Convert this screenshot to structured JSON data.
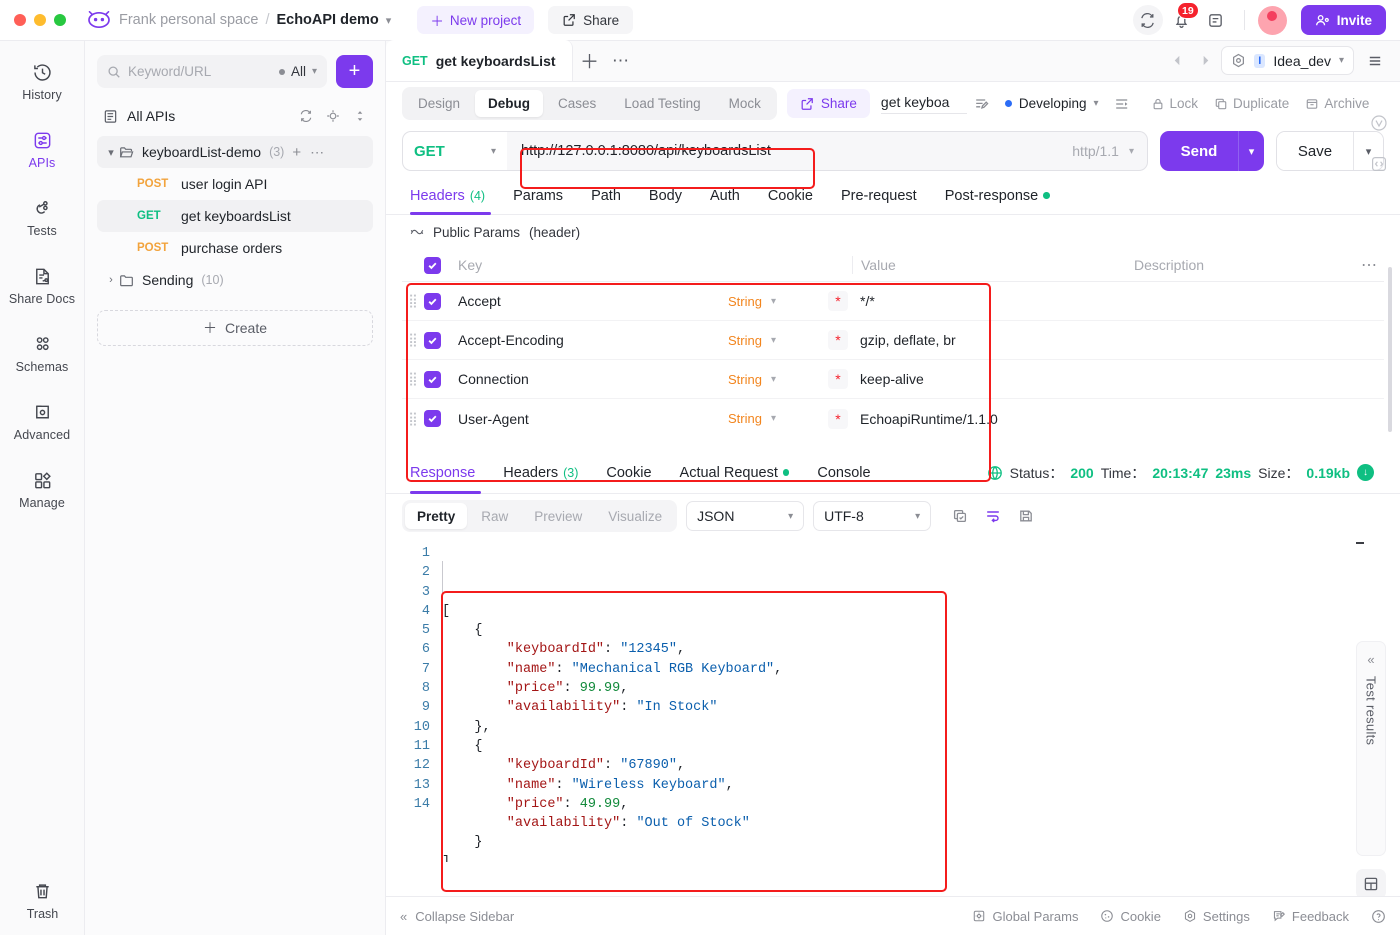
{
  "titlebar": {
    "workspace": "Frank personal space",
    "separator": "/",
    "project": "EchoAPI demo",
    "new_project": "New project",
    "share": "Share",
    "notification_count": "19",
    "invite": "Invite"
  },
  "rail": {
    "items": [
      {
        "label": "History",
        "icon": "history-icon",
        "active": false
      },
      {
        "label": "APIs",
        "icon": "apis-icon",
        "active": true
      },
      {
        "label": "Tests",
        "icon": "tests-icon",
        "active": false
      },
      {
        "label": "Share Docs",
        "icon": "share-docs-icon",
        "active": false
      },
      {
        "label": "Schemas",
        "icon": "schemas-icon",
        "active": false
      },
      {
        "label": "Advanced",
        "icon": "advanced-icon",
        "active": false
      },
      {
        "label": "Manage",
        "icon": "manage-icon",
        "active": false
      }
    ],
    "trash": "Trash"
  },
  "sidebar": {
    "search_placeholder": "Keyword/URL",
    "filter_label": "All",
    "add_button": "+",
    "all_apis": "All APIs",
    "folders": [
      {
        "name": "keyboardList-demo",
        "count": "(3)",
        "expanded": true
      },
      {
        "name": "Sending",
        "count": "(10)",
        "expanded": false
      }
    ],
    "apis": [
      {
        "method": "POST",
        "name": "user login API",
        "selected": false
      },
      {
        "method": "GET",
        "name": "get keyboardsList",
        "selected": true
      },
      {
        "method": "POST",
        "name": "purchase orders",
        "selected": false
      }
    ],
    "create": "Create"
  },
  "tabstrip": {
    "doc_tab_method": "GET",
    "doc_tab_name": "get keyboardsList",
    "env_name": "Idea_dev",
    "env_initial": "I"
  },
  "subbar": {
    "segments": [
      {
        "label": "Design",
        "active": false
      },
      {
        "label": "Debug",
        "active": true
      },
      {
        "label": "Cases",
        "active": false
      },
      {
        "label": "Load Testing",
        "active": false
      },
      {
        "label": "Mock",
        "active": false
      }
    ],
    "share": "Share",
    "api_name_value": "get keyboa",
    "status": "Developing",
    "actions": [
      {
        "label": "Lock",
        "icon": "lock-icon"
      },
      {
        "label": "Duplicate",
        "icon": "duplicate-icon"
      },
      {
        "label": "Archive",
        "icon": "archive-icon"
      }
    ]
  },
  "urlbar": {
    "method": "GET",
    "url": "http://127.0.0.1:8080/api/keyboardsList",
    "protocol": "http/1.1",
    "send": "Send",
    "save": "Save"
  },
  "request_tabs": [
    {
      "label": "Headers",
      "count": "(4)",
      "active": true,
      "dot": false
    },
    {
      "label": "Params",
      "count": "",
      "active": false,
      "dot": false
    },
    {
      "label": "Path",
      "count": "",
      "active": false,
      "dot": false
    },
    {
      "label": "Body",
      "count": "",
      "active": false,
      "dot": false
    },
    {
      "label": "Auth",
      "count": "",
      "active": false,
      "dot": false
    },
    {
      "label": "Cookie",
      "count": "",
      "active": false,
      "dot": false
    },
    {
      "label": "Pre-request",
      "count": "",
      "active": false,
      "dot": false
    },
    {
      "label": "Post-response",
      "count": "",
      "active": false,
      "dot": true
    }
  ],
  "public_params": {
    "label": "Public Params",
    "scope": "(header)"
  },
  "headers_table": {
    "columns": {
      "key": "Key",
      "value": "Value",
      "description": "Description"
    },
    "rows": [
      {
        "checked": true,
        "key": "Accept",
        "type": "String",
        "required": "*",
        "value": "*/*",
        "description": ""
      },
      {
        "checked": true,
        "key": "Accept-Encoding",
        "type": "String",
        "required": "*",
        "value": "gzip, deflate, br",
        "description": ""
      },
      {
        "checked": true,
        "key": "Connection",
        "type": "String",
        "required": "*",
        "value": "keep-alive",
        "description": ""
      },
      {
        "checked": true,
        "key": "User-Agent",
        "type": "String",
        "required": "*",
        "value": "EchoapiRuntime/1.1.0",
        "description": ""
      }
    ]
  },
  "response_tabs": [
    {
      "label": "Response",
      "count": "",
      "active": true,
      "dot": false
    },
    {
      "label": "Headers",
      "count": "(3)",
      "active": false,
      "dot": false
    },
    {
      "label": "Cookie",
      "count": "",
      "active": false,
      "dot": false
    },
    {
      "label": "Actual Request",
      "count": "",
      "active": false,
      "dot": true
    },
    {
      "label": "Console",
      "count": "",
      "active": false,
      "dot": false
    }
  ],
  "response_meta": {
    "status_label": "Status：",
    "status_value": "200",
    "time_label": "Time：",
    "time_value": "20:13:47",
    "duration_value": "23ms",
    "size_label": "Size：",
    "size_value": "0.19kb"
  },
  "formatbar": {
    "views": [
      {
        "label": "Pretty",
        "active": true
      },
      {
        "label": "Raw",
        "active": false
      },
      {
        "label": "Preview",
        "active": false
      },
      {
        "label": "Visualize",
        "active": false
      }
    ],
    "format": "JSON",
    "encoding": "UTF-8"
  },
  "response_body": {
    "line_numbers": [
      "1",
      "2",
      "3",
      "4",
      "5",
      "6",
      "7",
      "8",
      "9",
      "10",
      "11",
      "12",
      "13",
      "14"
    ],
    "lines": [
      [
        {
          "t": "p",
          "v": "["
        }
      ],
      [
        {
          "t": "p",
          "v": "    {"
        }
      ],
      [
        {
          "t": "k",
          "v": "        \"keyboardId\""
        },
        {
          "t": "p",
          "v": ": "
        },
        {
          "t": "s",
          "v": "\"12345\""
        },
        {
          "t": "p",
          "v": ","
        }
      ],
      [
        {
          "t": "k",
          "v": "        \"name\""
        },
        {
          "t": "p",
          "v": ": "
        },
        {
          "t": "s",
          "v": "\"Mechanical RGB Keyboard\""
        },
        {
          "t": "p",
          "v": ","
        }
      ],
      [
        {
          "t": "k",
          "v": "        \"price\""
        },
        {
          "t": "p",
          "v": ": "
        },
        {
          "t": "n",
          "v": "99.99"
        },
        {
          "t": "p",
          "v": ","
        }
      ],
      [
        {
          "t": "k",
          "v": "        \"availability\""
        },
        {
          "t": "p",
          "v": ": "
        },
        {
          "t": "s",
          "v": "\"In Stock\""
        }
      ],
      [
        {
          "t": "p",
          "v": "    },"
        }
      ],
      [
        {
          "t": "p",
          "v": "    {"
        }
      ],
      [
        {
          "t": "k",
          "v": "        \"keyboardId\""
        },
        {
          "t": "p",
          "v": ": "
        },
        {
          "t": "s",
          "v": "\"67890\""
        },
        {
          "t": "p",
          "v": ","
        }
      ],
      [
        {
          "t": "k",
          "v": "        \"name\""
        },
        {
          "t": "p",
          "v": ": "
        },
        {
          "t": "s",
          "v": "\"Wireless Keyboard\""
        },
        {
          "t": "p",
          "v": ","
        }
      ],
      [
        {
          "t": "k",
          "v": "        \"price\""
        },
        {
          "t": "p",
          "v": ": "
        },
        {
          "t": "n",
          "v": "49.99"
        },
        {
          "t": "p",
          "v": ","
        }
      ],
      [
        {
          "t": "k",
          "v": "        \"availability\""
        },
        {
          "t": "p",
          "v": ": "
        },
        {
          "t": "s",
          "v": "\"Out of Stock\""
        }
      ],
      [
        {
          "t": "p",
          "v": "    }"
        }
      ],
      [
        {
          "t": "p",
          "v": "]"
        }
      ]
    ]
  },
  "test_results": {
    "label": "Test results"
  },
  "bottombar": {
    "collapse": "Collapse Sidebar",
    "items": [
      {
        "label": "Global Params",
        "icon": "global-params-icon"
      },
      {
        "label": "Cookie",
        "icon": "cookie-icon"
      },
      {
        "label": "Settings",
        "icon": "settings-icon"
      },
      {
        "label": "Feedback",
        "icon": "feedback-icon"
      }
    ]
  },
  "colors": {
    "accent": "#7c3aed",
    "get_green": "#0fbf82",
    "post_orange": "#f2a33c",
    "annotation_red": "#f41c1c",
    "json_key": "#a31515",
    "json_string": "#0b5fad",
    "json_number": "#128a3b"
  }
}
